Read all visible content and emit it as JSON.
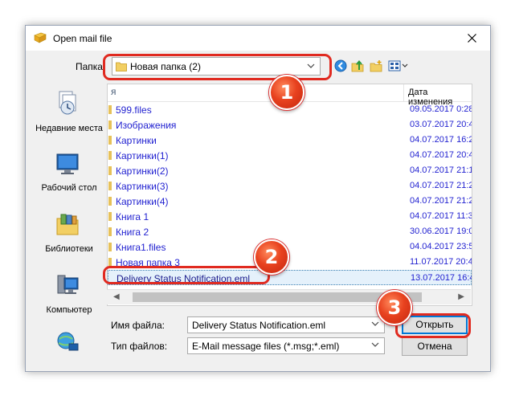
{
  "window": {
    "title": "Open mail file"
  },
  "folder": {
    "label": "Папка:",
    "current": "Новая папка (2)"
  },
  "places": [
    {
      "label": "Недавние места",
      "icon": "recent-places-icon"
    },
    {
      "label": "Рабочий стол",
      "icon": "desktop-icon"
    },
    {
      "label": "Библиотеки",
      "icon": "libraries-icon"
    },
    {
      "label": "Компьютер",
      "icon": "computer-icon"
    },
    {
      "label": "",
      "icon": "network-icon"
    }
  ],
  "file_list": {
    "col_name": "я",
    "col_date": "Дата изменения",
    "rows": [
      {
        "name": "599.files",
        "date": "09.05.2017 0:28"
      },
      {
        "name": "Изображения",
        "date": "03.07.2017 20:4"
      },
      {
        "name": "Картинки",
        "date": "04.07.2017 16:2"
      },
      {
        "name": "Картинки(1)",
        "date": "04.07.2017 20:4"
      },
      {
        "name": "Картинки(2)",
        "date": "04.07.2017 21:1"
      },
      {
        "name": "Картинки(3)",
        "date": "04.07.2017 21:2"
      },
      {
        "name": "Картинки(4)",
        "date": "04.07.2017 21:2"
      },
      {
        "name": "Книга 1",
        "date": "04.07.2017 11:3"
      },
      {
        "name": "Книга 2",
        "date": "30.06.2017 19:0"
      },
      {
        "name": "Книга1.files",
        "date": "04.04.2017 23:5"
      },
      {
        "name": "Новая папка 3",
        "date": "11.07.2017 20:4"
      },
      {
        "name": "Delivery Status Notification.eml",
        "date": "13.07.2017 16:4"
      }
    ]
  },
  "filename": {
    "label": "Имя файла:",
    "value": "Delivery Status Notification.eml"
  },
  "filetype": {
    "label": "Тип файлов:",
    "value": "E-Mail message files (*.msg;*.eml)"
  },
  "buttons": {
    "open": "Открыть",
    "cancel": "Отмена"
  },
  "annotations": {
    "badge1": "1",
    "badge2": "2",
    "badge3": "3"
  },
  "colors": {
    "annotation_red": "#e02a20",
    "link_blue": "#1f1fd0",
    "selection": "#e5f1fb",
    "focus_border": "#0078d7"
  }
}
